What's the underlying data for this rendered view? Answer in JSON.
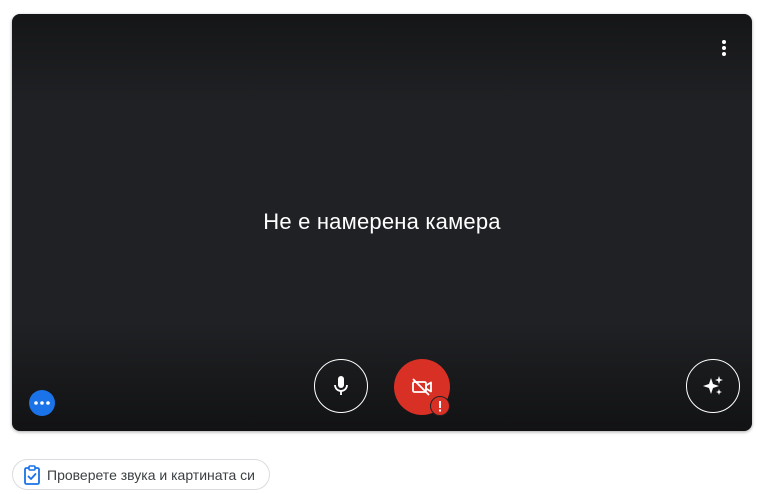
{
  "preview": {
    "status_text": "Не е намерена камера",
    "background_color": "#202124"
  },
  "controls": {
    "more_options_icon": "more-vert-icon",
    "mic_icon": "microphone-icon",
    "camera_icon": "videocam-off-icon",
    "camera_state_color": "#d93025",
    "warning_icon": "exclamation-icon",
    "effects_icon": "sparkle-icon",
    "extra_menu_icon": "more-horiz-icon",
    "extra_menu_color": "#1a73e8"
  },
  "check_chip": {
    "label": "Проверете звука и картината си",
    "icon": "clipboard-check-icon",
    "icon_color": "#1a73e8"
  }
}
